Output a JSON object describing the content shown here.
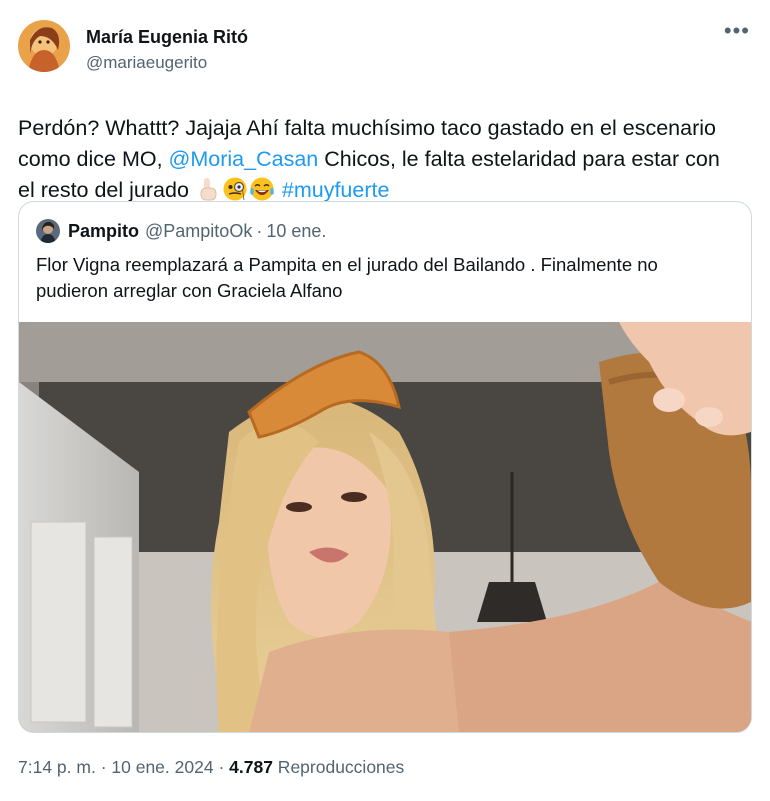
{
  "author": {
    "display_name": "María Eugenia Ritó",
    "handle": "@mariaeugerito"
  },
  "menu": {
    "more_glyph": "•••"
  },
  "tweet": {
    "text_line1": "Perdón? Whattt? Jajaja Ahí falta muchísimo taco gastado en el escenario",
    "text_line2_a": "como dice MO, ",
    "mention": "@Moria_Casan",
    "text_line2_b": " Chicos, le falta estelaridad para estar con",
    "text_line3": "el resto del jurado ",
    "hashtag": "#muyfuerte",
    "emojis": [
      "pointing-up-emoji",
      "monocle-face-emoji",
      "tears-of-joy-emoji"
    ]
  },
  "quoted": {
    "display_name": "Pampito",
    "handle": "@PampitoOk",
    "separator": "·",
    "date": "10 ene.",
    "text": "Flor Vigna reemplazará a Pampita en el jurado del Bailando . Finalmente no pudieron arreglar con Graciela Alfano"
  },
  "meta": {
    "time": "7:14 p. m.",
    "sep1": " · ",
    "date": "10 ene. 2024",
    "sep2": " · ",
    "views_count": "4.787",
    "views_label": " Reproducciones"
  },
  "colors": {
    "link": "#1d9bf0",
    "secondary": "#536471",
    "border": "#cfd9de"
  }
}
